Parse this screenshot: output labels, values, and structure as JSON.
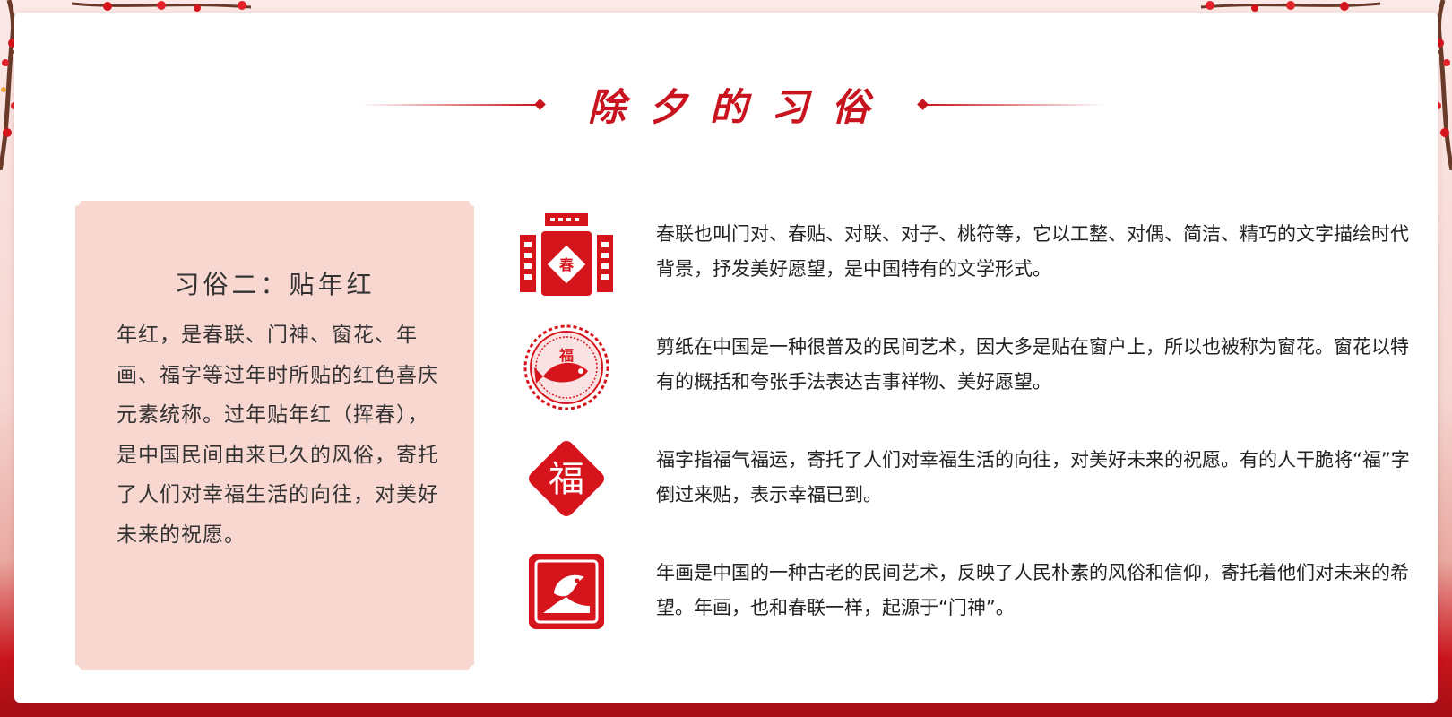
{
  "title": "除夕的习俗",
  "panel": {
    "heading": "习俗二：贴年红",
    "body": "年红，是春联、门神、窗花、年画、福字等过年时所贴的红色喜庆元素统称。过年贴年红（挥春），是中国民间由来已久的风俗，寄托了人们对幸福生活的向往，对美好未来的祝愿。"
  },
  "items": [
    {
      "icon": "couplet-icon",
      "icon_char": "春",
      "text": "春联也叫门对、春贴、对联、对子、桃符等，它以工整、对偶、简洁、精巧的文字描绘时代背景，抒发美好愿望，是中国特有的文学形式。"
    },
    {
      "icon": "papercut-icon",
      "icon_char": "福",
      "text": "剪纸在中国是一种很普及的民间艺术，因大多是贴在窗户上，所以也被称为窗花。窗花以特有的概括和夸张手法表达吉事祥物、美好愿望。"
    },
    {
      "icon": "fu-character-icon",
      "icon_char": "福",
      "text": "福字指福气福运，寄托了人们对幸福生活的向往，对美好未来的祝愿。有的人干脆将“福”字倒过来贴，表示幸福已到。"
    },
    {
      "icon": "new-year-painting-icon",
      "text": "年画是中国的一种古老的民间艺术，反映了人民朴素的风俗和信仰，寄托着他们对未来的希望。年画，也和春联一样，起源于“门神”。"
    }
  ],
  "colors": {
    "accent": "#c8141e",
    "panel": "#f9d7d1",
    "text": "#222222"
  }
}
